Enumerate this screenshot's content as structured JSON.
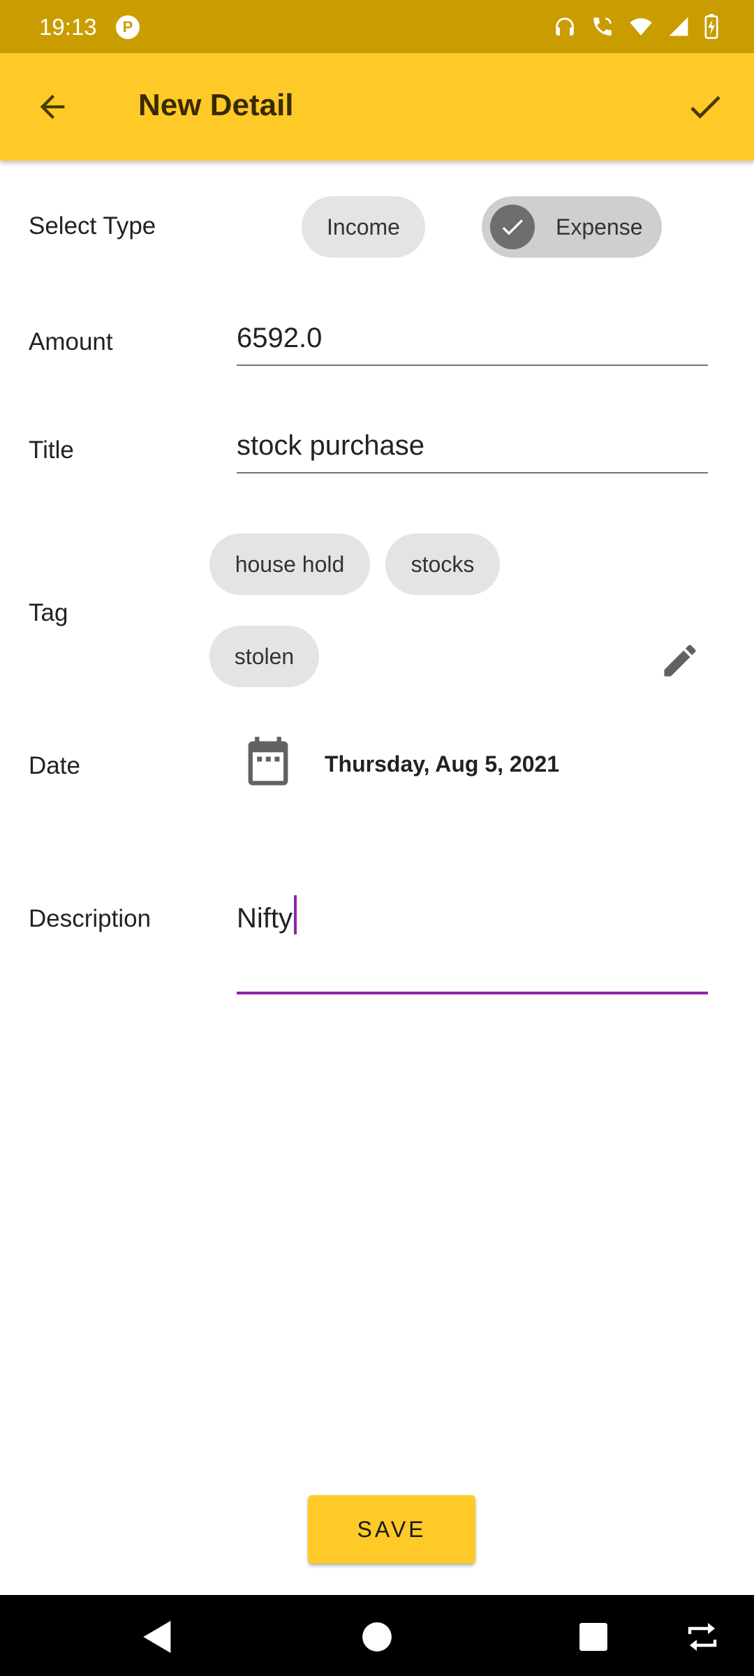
{
  "status_bar": {
    "time": "19:13",
    "app_icon_letter": "P",
    "icons": [
      "headphones-icon",
      "wifi-calling-icon",
      "wifi-icon",
      "signal-icon",
      "battery-charging-icon"
    ]
  },
  "app_bar": {
    "title": "New Detail",
    "back_icon": "arrow-left-icon",
    "confirm_icon": "check-icon",
    "color": "#FFCA28"
  },
  "form": {
    "type": {
      "label": "Select Type",
      "options": [
        "Income",
        "Expense"
      ],
      "selected": "Expense"
    },
    "amount": {
      "label": "Amount",
      "value": "6592.0"
    },
    "title": {
      "label": "Title",
      "value": "stock purchase"
    },
    "tag": {
      "label": "Tag",
      "tags": [
        "house hold",
        "stocks",
        "stolen"
      ],
      "edit_icon": "pencil-icon"
    },
    "date": {
      "label": "Date",
      "value": "Thursday, Aug 5, 2021",
      "icon": "calendar-icon"
    },
    "description": {
      "label": "Description",
      "value": "Nifty"
    }
  },
  "save_button": {
    "label": "SAVE"
  },
  "nav_bar": {
    "icons": [
      "back-triangle-icon",
      "home-circle-icon",
      "recents-square-icon",
      "rotate-icon"
    ]
  },
  "colors": {
    "status_bar": "#C99D00",
    "accent": "#FFCA28",
    "focus": "#8E24AA"
  }
}
